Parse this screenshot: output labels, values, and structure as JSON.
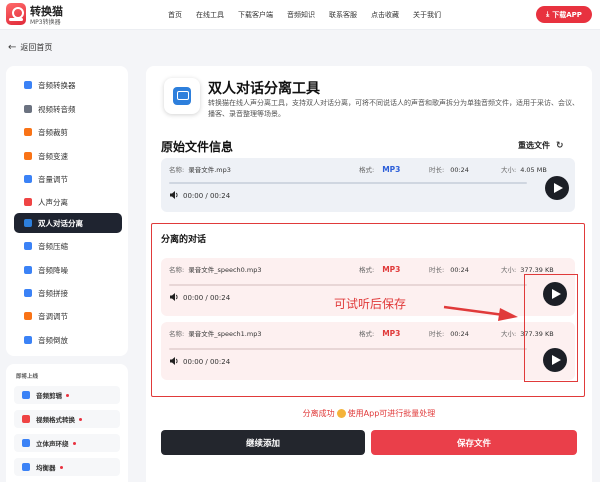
{
  "header": {
    "brand": "转换猫",
    "brand_sub": "MP3转换器",
    "nav": [
      "首页",
      "在线工具",
      "下载客户端",
      "音频知识",
      "联系客服",
      "点击收藏",
      "关于我们"
    ],
    "download_app": "下载APP"
  },
  "back_label": "返回首页",
  "sidebar": {
    "items": [
      {
        "label": "音频转换器",
        "color": "#3b82f6"
      },
      {
        "label": "视频转音频",
        "color": "#6b7280"
      },
      {
        "label": "音频裁剪",
        "color": "#f97316"
      },
      {
        "label": "音频变速",
        "color": "#f97316"
      },
      {
        "label": "音量调节",
        "color": "#3b82f6"
      },
      {
        "label": "人声分离",
        "color": "#ef4444"
      },
      {
        "label": "双人对话分离",
        "color": "#2d7fdc"
      },
      {
        "label": "音频压缩",
        "color": "#3b82f6"
      },
      {
        "label": "音频降噪",
        "color": "#3b82f6"
      },
      {
        "label": "音频拼接",
        "color": "#3b82f6"
      },
      {
        "label": "音调调节",
        "color": "#f97316"
      },
      {
        "label": "音频倒放",
        "color": "#3b82f6"
      }
    ],
    "active_index": 6
  },
  "sidebar2": {
    "title": "即将上线",
    "items": [
      "音频剪辑",
      "视频格式转换",
      "立体声环绕",
      "均衡器"
    ]
  },
  "main": {
    "title": "双人对话分离工具",
    "description": "转换猫在线人声分离工具，支持双人对话分离，可将不同说话人的声音和歌声拆分为单独音频文件，适用于采访、会议、播客、录音整理等场景。",
    "original_section": "原始文件信息",
    "reselect": "重选文件",
    "original_file": {
      "name_label": "名称:",
      "name": "录音文件.mp3",
      "format_label": "格式:",
      "format": "MP3",
      "duration_label": "时长:",
      "duration": "00:24",
      "size_label": "大小:",
      "size": "4.05 MB",
      "time": "00:00 / 00:24"
    },
    "separated_section": "分离的对话",
    "separated_files": [
      {
        "name_label": "名称:",
        "name": "录音文件_speech0.mp3",
        "format_label": "格式:",
        "format": "MP3",
        "duration_label": "时长:",
        "duration": "00:24",
        "size_label": "大小:",
        "size": "377.39 KB",
        "time": "00:00 / 00:24"
      },
      {
        "name_label": "名称:",
        "name": "录音文件_speech1.mp3",
        "format_label": "格式:",
        "format": "MP3",
        "duration_label": "时长:",
        "duration": "00:24",
        "size_label": "大小:",
        "size": "377.39 KB",
        "time": "00:00 / 00:24"
      }
    ],
    "annotation": "可试听后保存",
    "status_pre": "分离成功",
    "status_post": "使用App可进行批量处理",
    "continue_button": "继续添加",
    "save_button": "保存文件"
  },
  "colors": {
    "accent": "#e8323f",
    "format_original": "#2d5fd9",
    "format_separated": "#e03a3a",
    "dark": "#1f2430"
  }
}
